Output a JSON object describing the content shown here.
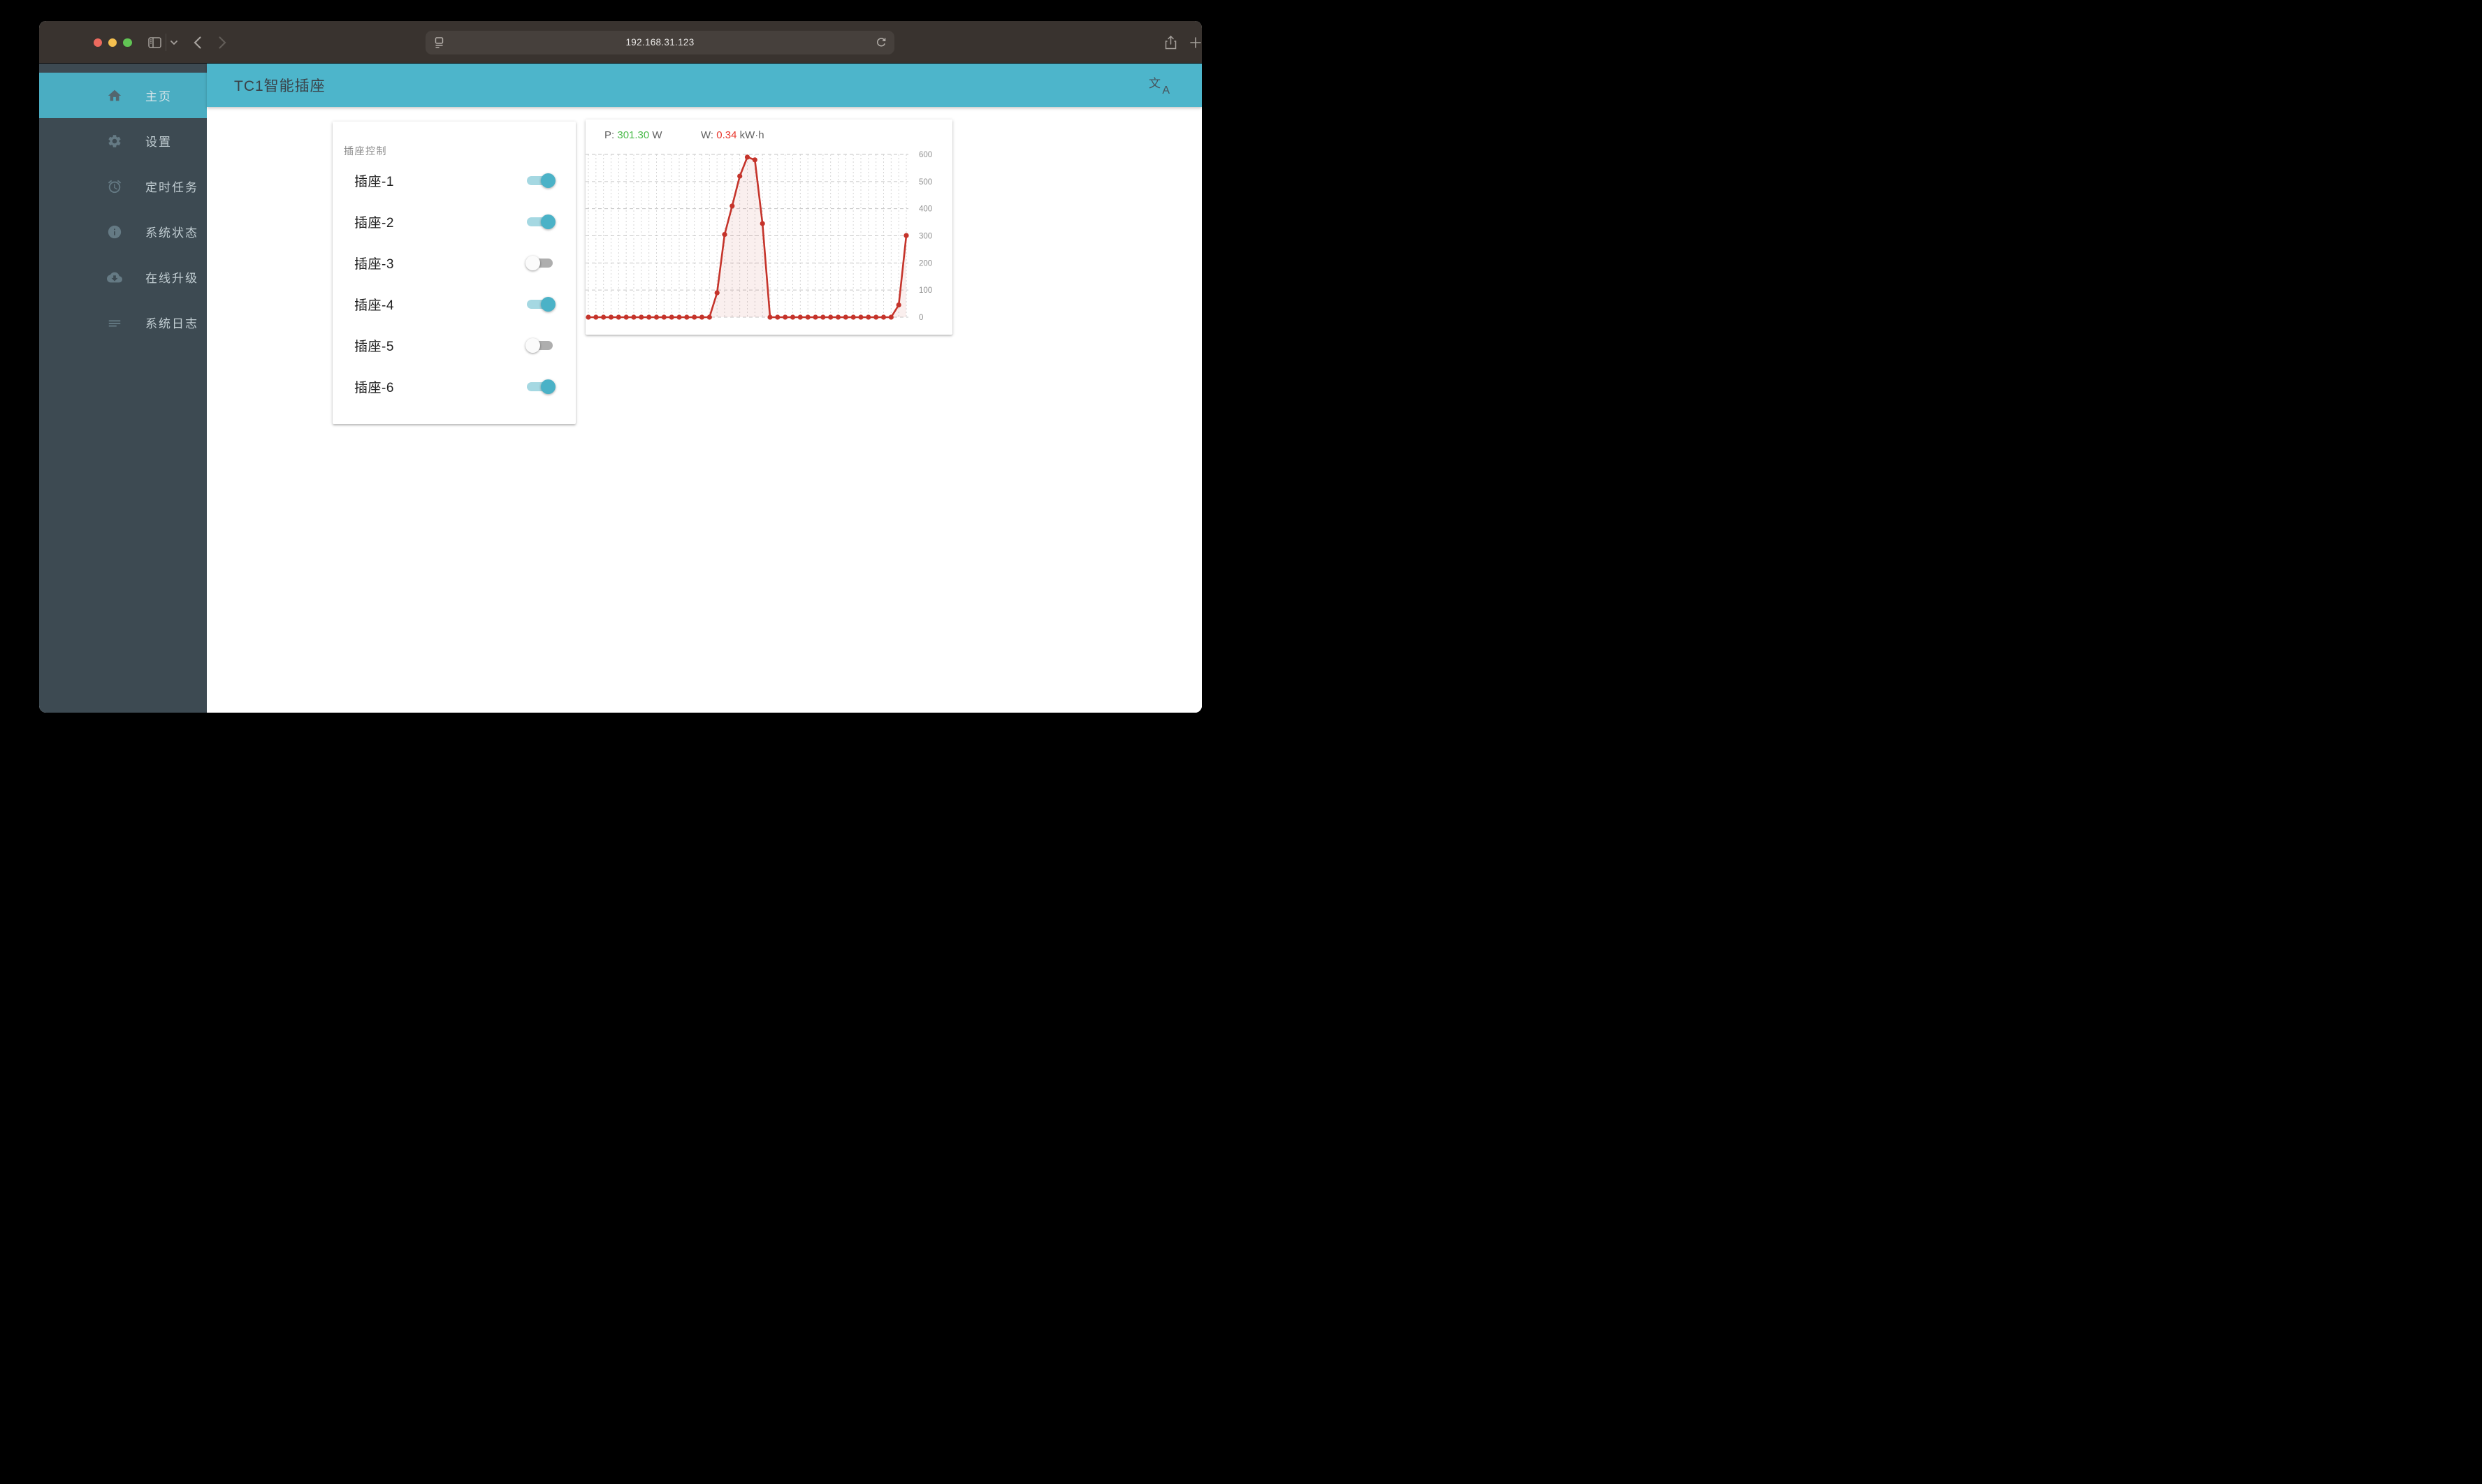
{
  "browser": {
    "url": "192.168.31.123",
    "window_controls": [
      "close",
      "minimize",
      "zoom"
    ]
  },
  "header": {
    "title": "TC1智能插座",
    "translate_zh": "文",
    "translate_a": "A"
  },
  "sidebar": {
    "items": [
      {
        "label": "主页",
        "icon": "home",
        "active": true
      },
      {
        "label": "设置",
        "icon": "gear",
        "active": false
      },
      {
        "label": "定时任务",
        "icon": "alarm",
        "active": false
      },
      {
        "label": "系统状态",
        "icon": "info",
        "active": false
      },
      {
        "label": "在线升级",
        "icon": "cloud-download",
        "active": false
      },
      {
        "label": "系统日志",
        "icon": "logs",
        "active": false
      }
    ]
  },
  "socket_card": {
    "title": "插座控制",
    "sockets": [
      {
        "label": "插座-1",
        "on": true
      },
      {
        "label": "插座-2",
        "on": true
      },
      {
        "label": "插座-3",
        "on": false
      },
      {
        "label": "插座-4",
        "on": true
      },
      {
        "label": "插座-5",
        "on": false
      },
      {
        "label": "插座-6",
        "on": true
      }
    ]
  },
  "chart_card": {
    "power_label": "P:",
    "power_value": "301.30",
    "power_unit": "W",
    "energy_label": "W:",
    "energy_value": "0.34",
    "energy_unit": "kW·h",
    "power_color": "#4CBB4C",
    "energy_color": "#E8382E"
  },
  "chart_data": {
    "type": "line",
    "title": "",
    "xlabel": "",
    "ylabel": "",
    "values": [
      0,
      0,
      0,
      0,
      0,
      0,
      0,
      0,
      0,
      0,
      0,
      0,
      0,
      0,
      0,
      0,
      0,
      90,
      305,
      410,
      520,
      590,
      580,
      345,
      0,
      0,
      0,
      0,
      0,
      0,
      0,
      0,
      0,
      0,
      0,
      0,
      0,
      0,
      0,
      0,
      0,
      45,
      301
    ],
    "ylim": [
      0,
      600
    ],
    "yticks": [
      600,
      500,
      400,
      300,
      200,
      100,
      0
    ],
    "grid": true,
    "legend_position": "none",
    "line_color": "#C5342B",
    "fill_color": "rgba(197,52,43,0.08)",
    "marker": "circle"
  }
}
